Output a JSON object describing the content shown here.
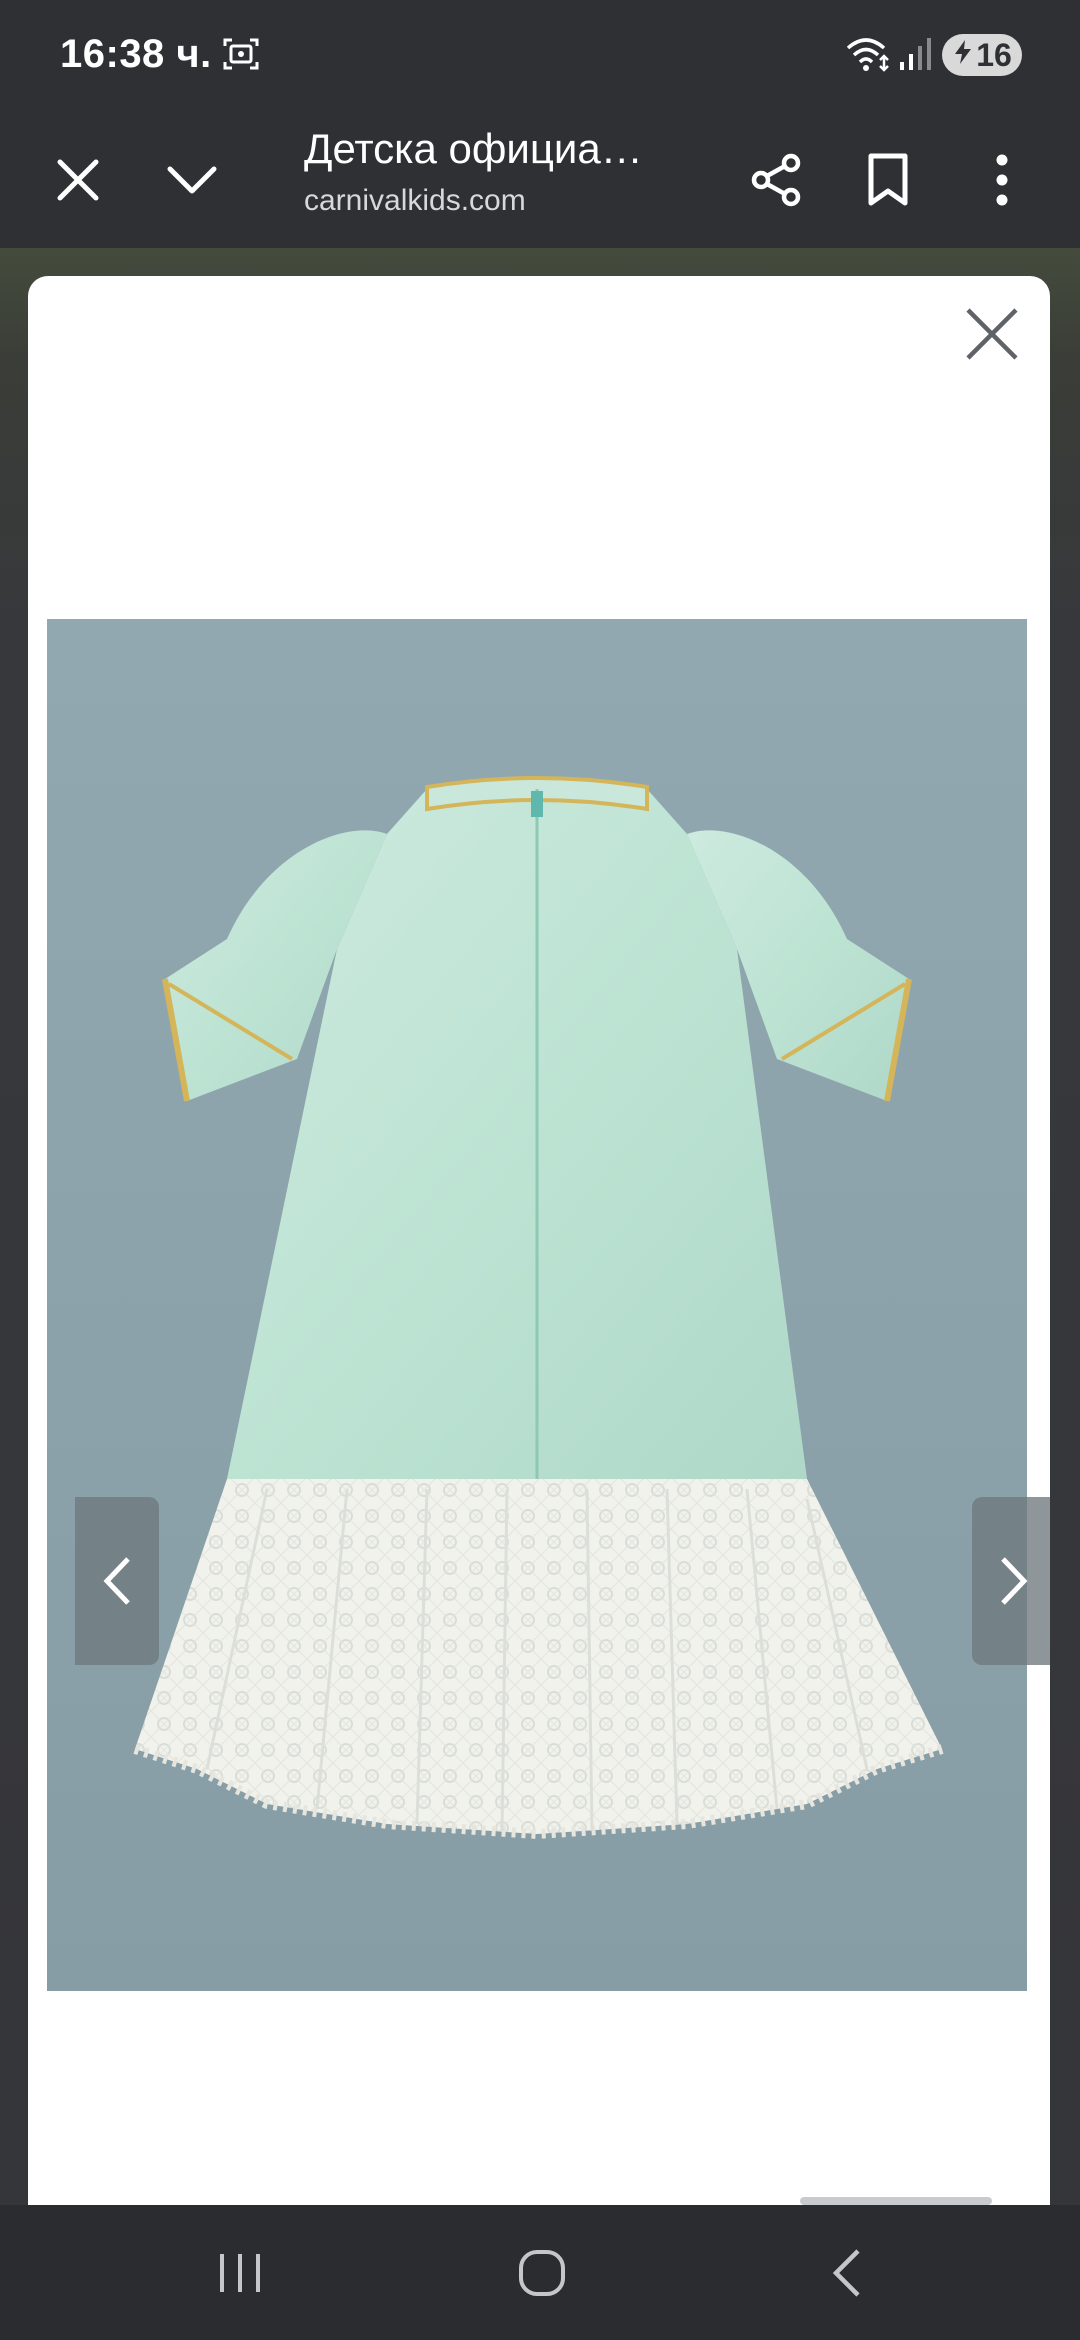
{
  "status_bar": {
    "time": "16:38 ч.",
    "battery": "16",
    "icons": [
      "screenshot-icon",
      "wifi-icon",
      "signal-icon",
      "battery-saver-icon"
    ]
  },
  "toolbar": {
    "title": "Детска официа…",
    "url": "carnivalkids.com",
    "icons": [
      "close-icon",
      "chevron-down-icon",
      "share-icon",
      "bookmark-icon",
      "more-vert-icon"
    ]
  },
  "dialog": {
    "icons": [
      "close-icon",
      "chevron-left-icon",
      "chevron-right-icon"
    ]
  },
  "nav_bar": {
    "icons": [
      "recents-icon",
      "home-icon",
      "back-icon"
    ]
  },
  "colors": {
    "chrome": "#2f3034",
    "image_background": "#8fa5ac",
    "dress_mint": "#bfe3d4",
    "lace_white": "#f3f3ee",
    "gold_trim": "#d4b55a"
  }
}
